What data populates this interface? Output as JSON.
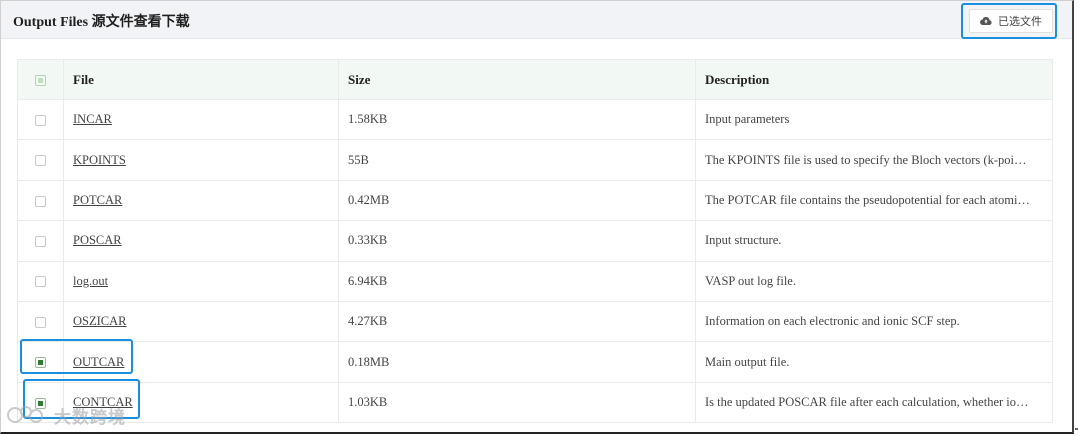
{
  "header": {
    "title": "Output Files 源文件查看下载",
    "selected_files_label": "已选文件",
    "selected_files_icon": "cloud-upload-icon"
  },
  "table": {
    "columns": [
      "File",
      "Size",
      "Description"
    ],
    "select_all_state": "indeterminate",
    "rows": [
      {
        "file": "INCAR",
        "size": "1.58KB",
        "description": "Input parameters",
        "checked": false
      },
      {
        "file": "KPOINTS",
        "size": "55B",
        "description": "The KPOINTS file is used to specify the Bloch vectors (k-poi…",
        "checked": false
      },
      {
        "file": "POTCAR",
        "size": "0.42MB",
        "description": "The POTCAR file contains the pseudopotential for each atomi…",
        "checked": false
      },
      {
        "file": "POSCAR",
        "size": "0.33KB",
        "description": "Input structure.",
        "checked": false
      },
      {
        "file": "log.out",
        "size": "6.94KB",
        "description": "VASP out log file.",
        "checked": false
      },
      {
        "file": "OSZICAR",
        "size": "4.27KB",
        "description": "Information on each electronic and ionic SCF step.",
        "checked": false
      },
      {
        "file": "OUTCAR",
        "size": "0.18MB",
        "description": "Main output file.",
        "checked": true
      },
      {
        "file": "CONTCAR",
        "size": "1.03KB",
        "description": "Is the updated POSCAR file after each calculation, whether io…",
        "checked": true
      }
    ]
  },
  "watermark": {
    "text": "大数跨境"
  },
  "colors": {
    "highlight": "#1a8fe0",
    "header_bg": "#f1f3f6",
    "table_head_bg": "#f2f8f3",
    "check_green": "#2e7d32"
  }
}
